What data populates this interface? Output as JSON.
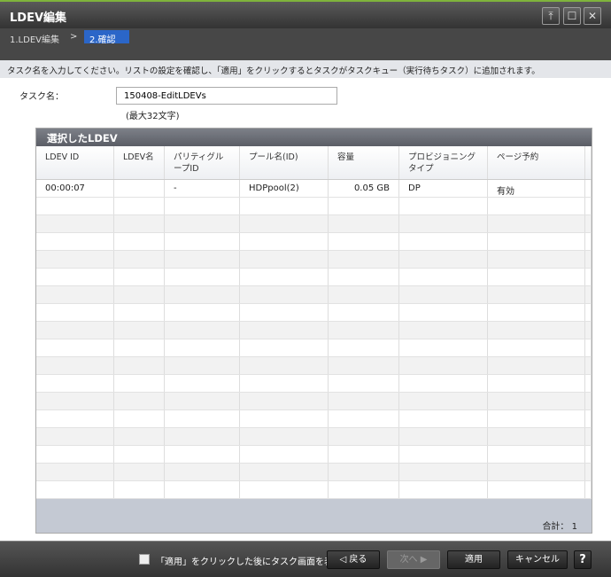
{
  "window": {
    "title": "LDEV編集",
    "pin_icon": "pin-icon",
    "maximize_icon": "maximize-icon",
    "close_icon": "close-icon"
  },
  "breadcrumb": {
    "step1": "1.LDEV編集",
    "separator": ">",
    "step2": "2.確認"
  },
  "instruction": "タスク名を入力してください。リストの設定を確認し、「適用」をクリックするとタスクがタスクキュー（実行待ちタスク）に追加されます。",
  "task": {
    "label": "タスク名：",
    "value": "150408-EditLDEVs",
    "hint": "(最大32文字)"
  },
  "panel": {
    "title": "選択したLDEV",
    "columns": [
      "LDEV ID",
      "LDEV名",
      "パリティグループID",
      "プール名(ID)",
      "容量",
      "プロビジョニングタイプ",
      "ページ予約"
    ],
    "rows": [
      [
        "00:00:07",
        "",
        "-",
        "HDPpool(2)",
        "0.05 GB",
        "DP",
        "有効"
      ]
    ],
    "total_label": "合計：",
    "total_value": "1"
  },
  "footer": {
    "checkbox_label": "「適用」をクリックした後にタスク画面を表示",
    "checkbox_checked": false,
    "back": "◁ 戻る",
    "next": "次へ ▶",
    "apply": "適用",
    "cancel": "キャンセル",
    "help": "?"
  },
  "colors": {
    "accent": "#2b66c8",
    "title_line": "#7fb43c"
  }
}
